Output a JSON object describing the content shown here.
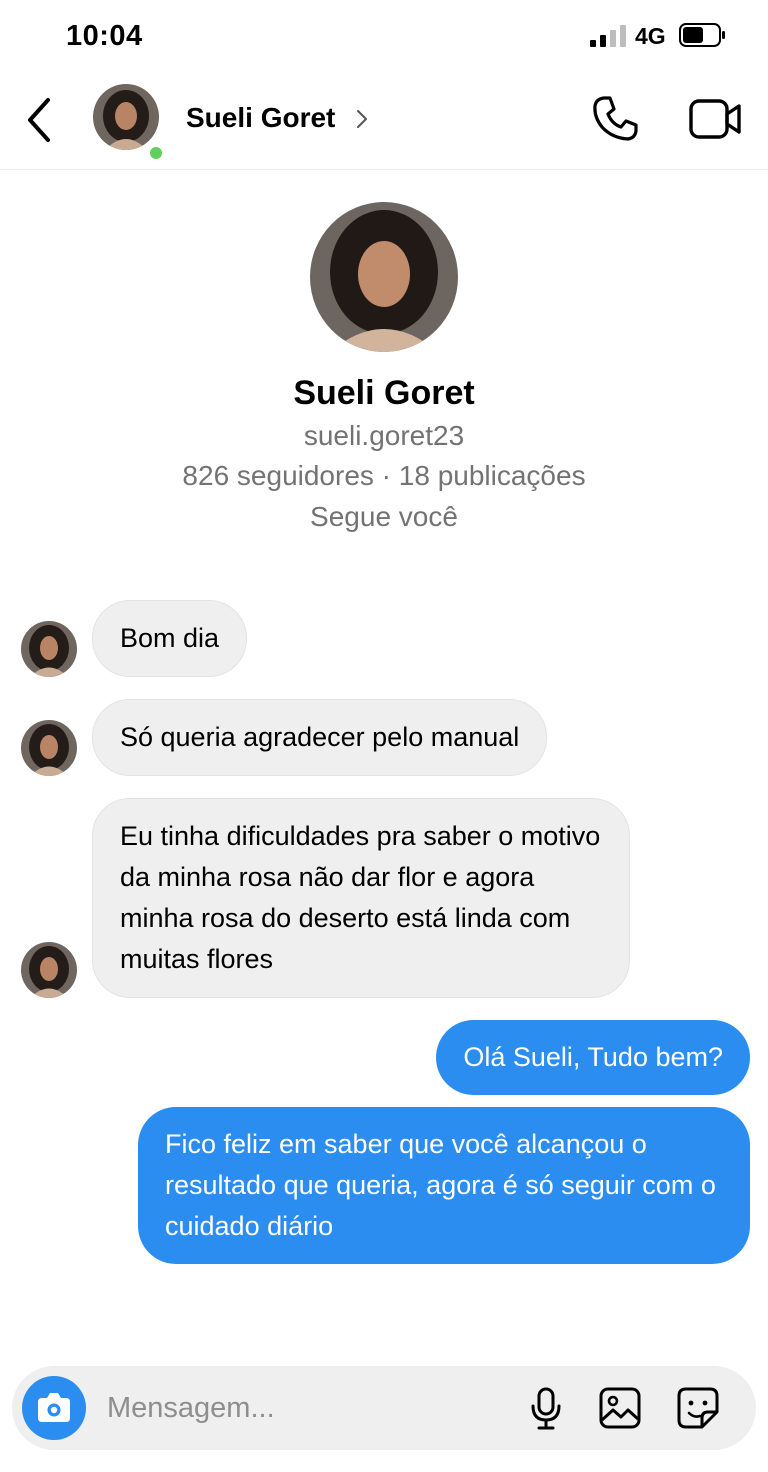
{
  "status_bar": {
    "time": "10:04",
    "network": "4G",
    "icons": [
      "signal-icon",
      "battery-icon"
    ]
  },
  "header": {
    "name": "Sueli Goret",
    "online": true,
    "icons": [
      "back-chevron-icon",
      "chevron-right-icon",
      "phone-icon",
      "video-camera-icon"
    ]
  },
  "profile": {
    "name": "Sueli Goret",
    "username": "sueli.goret23",
    "stats": "826 seguidores · 18 publicações",
    "follows_you": "Segue você"
  },
  "messages": [
    {
      "direction": "incoming",
      "text": "Bom dia"
    },
    {
      "direction": "incoming",
      "text": "Só queria agradecer pelo manual"
    },
    {
      "direction": "incoming",
      "text": "Eu tinha dificuldades pra saber o motivo da minha rosa não dar flor e agora minha rosa do deserto está linda com muitas flores"
    },
    {
      "direction": "outgoing",
      "text": "Olá Sueli, Tudo bem?"
    },
    {
      "direction": "outgoing",
      "text": "Fico feliz em saber que você alcançou o resultado que queria, agora é só seguir com o cuidado diário"
    }
  ],
  "composer": {
    "placeholder": "Mensagem...",
    "icons": [
      "camera-icon",
      "microphone-icon",
      "gallery-icon",
      "sticker-icon"
    ]
  },
  "colors": {
    "accent": "#2b8df0",
    "incoming_bubble": "#efefef",
    "secondary_text": "#737373",
    "online": "#5fd05a"
  }
}
